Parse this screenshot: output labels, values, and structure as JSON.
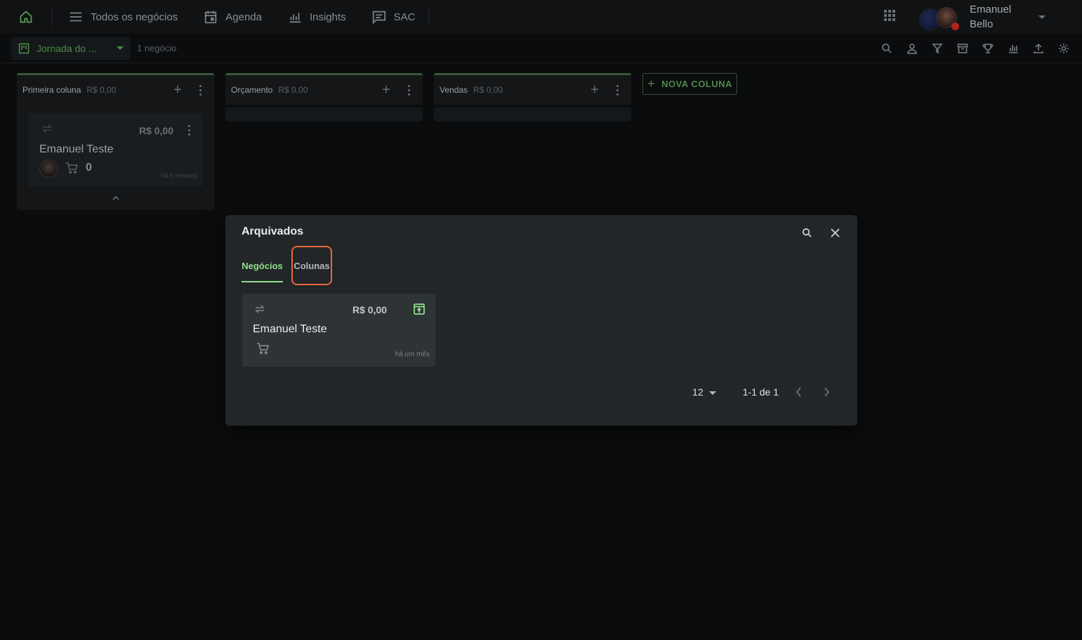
{
  "nav": {
    "items": [
      {
        "label": "Todos os negócios",
        "icon": "list-icon"
      },
      {
        "label": "Agenda",
        "icon": "calendar-icon"
      },
      {
        "label": "Insights",
        "icon": "bar-chart-icon"
      },
      {
        "label": "SAC",
        "icon": "chat-icon"
      }
    ],
    "user_first": "Emanuel",
    "user_last": "Bello"
  },
  "subbar": {
    "board_name": "Jornada do ...",
    "deals_count": "1 negócio"
  },
  "columns": [
    {
      "title": "Primeira coluna",
      "sum": "R$ 0,00"
    },
    {
      "title": "Orçamento",
      "sum": "R$ 0,00"
    },
    {
      "title": "Vendas",
      "sum": "R$ 0,00"
    }
  ],
  "board_card": {
    "value": "R$ 0,00",
    "name": "Emanuel Teste",
    "quantity": "0",
    "time": "há 5 minutos"
  },
  "new_column_label": "NOVA COLUNA",
  "dialog": {
    "title": "Arquivados",
    "tabs": [
      "Negócios",
      "Colunas"
    ],
    "active_tab": "Negócios",
    "card": {
      "value": "R$ 0,00",
      "name": "Emanuel Teste",
      "time": "há um mês"
    },
    "pagination": {
      "per_page": "12",
      "range": "1-1 de 1"
    }
  },
  "colors": {
    "accent_green": "#8fe08a",
    "dark_green": "#4f8a4a",
    "highlight_orange": "#e8683a"
  }
}
